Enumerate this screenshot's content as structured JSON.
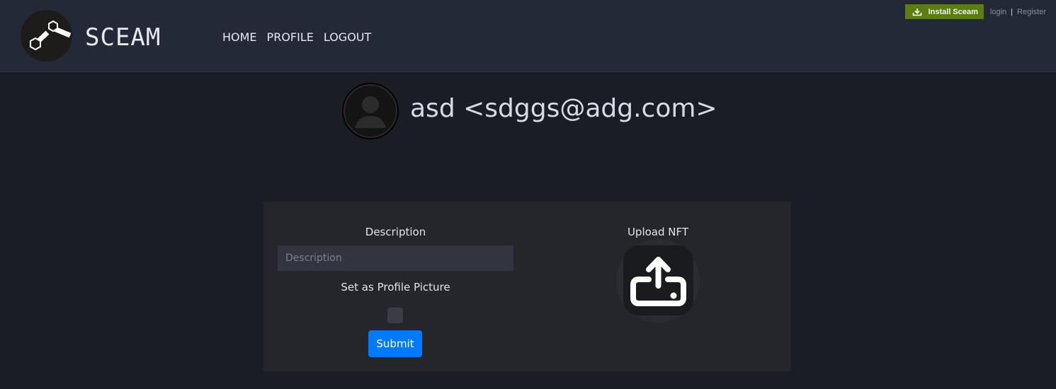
{
  "header": {
    "brand": "SCEAM",
    "nav": [
      "HOME",
      "PROFILE",
      "LOGOUT"
    ],
    "install_label": "Install Sceam",
    "login_label": "login",
    "separator": "|",
    "register_label": "Register"
  },
  "profile": {
    "name": "asd <sdggs@adg.com>"
  },
  "form": {
    "description_label": "Description",
    "description_placeholder": "Description",
    "description_value": "",
    "profile_picture_label": "Set as Profile Picture",
    "profile_picture_checked": false,
    "submit_label": "Submit",
    "upload_label": "Upload NFT"
  },
  "icons": {
    "logo": "hexagon-molecule-logo",
    "install": "download-icon",
    "avatar": "user-avatar-icon",
    "upload": "upload-icon"
  },
  "colors": {
    "install_button": "#5c7e10",
    "submit_button": "#007bff",
    "header_bg": "#242938",
    "page_bg": "#1b1d24"
  }
}
